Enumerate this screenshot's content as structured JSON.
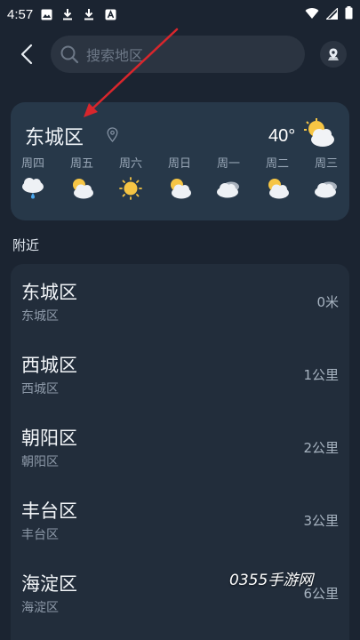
{
  "status_bar": {
    "time": "4:57"
  },
  "header": {
    "search_placeholder": "搜索地区"
  },
  "current": {
    "city": "东城区",
    "temperature": "40°",
    "icon": "partly-cloudy-icon"
  },
  "forecast": [
    {
      "day": "周四",
      "icon": "rain-icon"
    },
    {
      "day": "周五",
      "icon": "partly-cloudy-icon"
    },
    {
      "day": "周六",
      "icon": "sunny-icon"
    },
    {
      "day": "周日",
      "icon": "partly-cloudy-icon"
    },
    {
      "day": "周一",
      "icon": "cloudy-icon"
    },
    {
      "day": "周二",
      "icon": "partly-cloudy-icon"
    },
    {
      "day": "周三",
      "icon": "cloudy-icon"
    }
  ],
  "nearby": {
    "label": "附近",
    "items": [
      {
        "name": "东城区",
        "sub": "东城区",
        "distance": "0米"
      },
      {
        "name": "西城区",
        "sub": "西城区",
        "distance": "1公里"
      },
      {
        "name": "朝阳区",
        "sub": "朝阳区",
        "distance": "2公里"
      },
      {
        "name": "丰台区",
        "sub": "丰台区",
        "distance": "3公里"
      },
      {
        "name": "海淀区",
        "sub": "海淀区",
        "distance": "6公里"
      }
    ]
  },
  "watermark": "0355手游网",
  "colors": {
    "background": "#1b2431",
    "card": "#273849",
    "list": "#222d3b",
    "arrow": "#d8262c"
  }
}
